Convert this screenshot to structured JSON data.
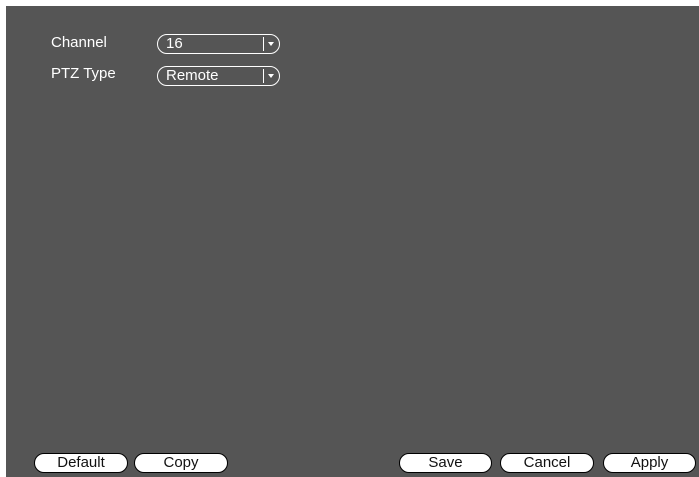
{
  "form": {
    "channel": {
      "label": "Channel",
      "value": "16"
    },
    "ptz_type": {
      "label": "PTZ Type",
      "value": "Remote"
    }
  },
  "buttons": {
    "default": "Default",
    "copy": "Copy",
    "save": "Save",
    "cancel": "Cancel",
    "apply": "Apply"
  },
  "icons": {
    "dropdown": "chevron-down-icon"
  },
  "colors": {
    "panel_background": "#555555",
    "text": "#ffffff",
    "button_background": "#ffffff"
  }
}
